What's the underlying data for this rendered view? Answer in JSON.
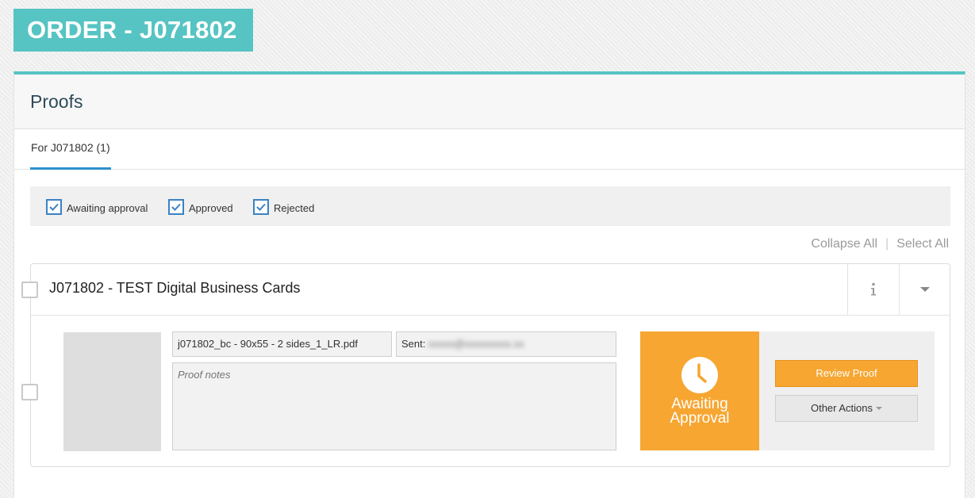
{
  "order": {
    "title": "ORDER - J071802"
  },
  "panel": {
    "title": "Proofs"
  },
  "tabs": [
    {
      "label": "For J071802 (1)",
      "active": true
    }
  ],
  "filters": [
    {
      "label": "Awaiting approval",
      "checked": true
    },
    {
      "label": "Approved",
      "checked": true
    },
    {
      "label": "Rejected",
      "checked": true
    }
  ],
  "actions": {
    "collapse_all": "Collapse All",
    "separator": "|",
    "select_all": "Select All"
  },
  "job": {
    "title": "J071802 - TEST Digital Business Cards",
    "info_icon": "info-icon",
    "menu_icon": "caret-down-icon",
    "proof": {
      "filename": "j071802_bc - 90x55 - 2 sides_1_LR.pdf",
      "sent_label": "Sent:",
      "sent_value": "xxxxx@xxxxxxxxx.xx",
      "notes_placeholder": "Proof notes",
      "status_line1": "Awaiting",
      "status_line2": "Approval",
      "status_icon": "clock-icon",
      "review_button": "Review Proof",
      "other_actions_button": "Other Actions"
    }
  },
  "colors": {
    "accent": "#56c4c2",
    "status_orange": "#f6a631",
    "checkbox_blue": "#3b82c4",
    "tab_blue": "#2c8fca"
  }
}
